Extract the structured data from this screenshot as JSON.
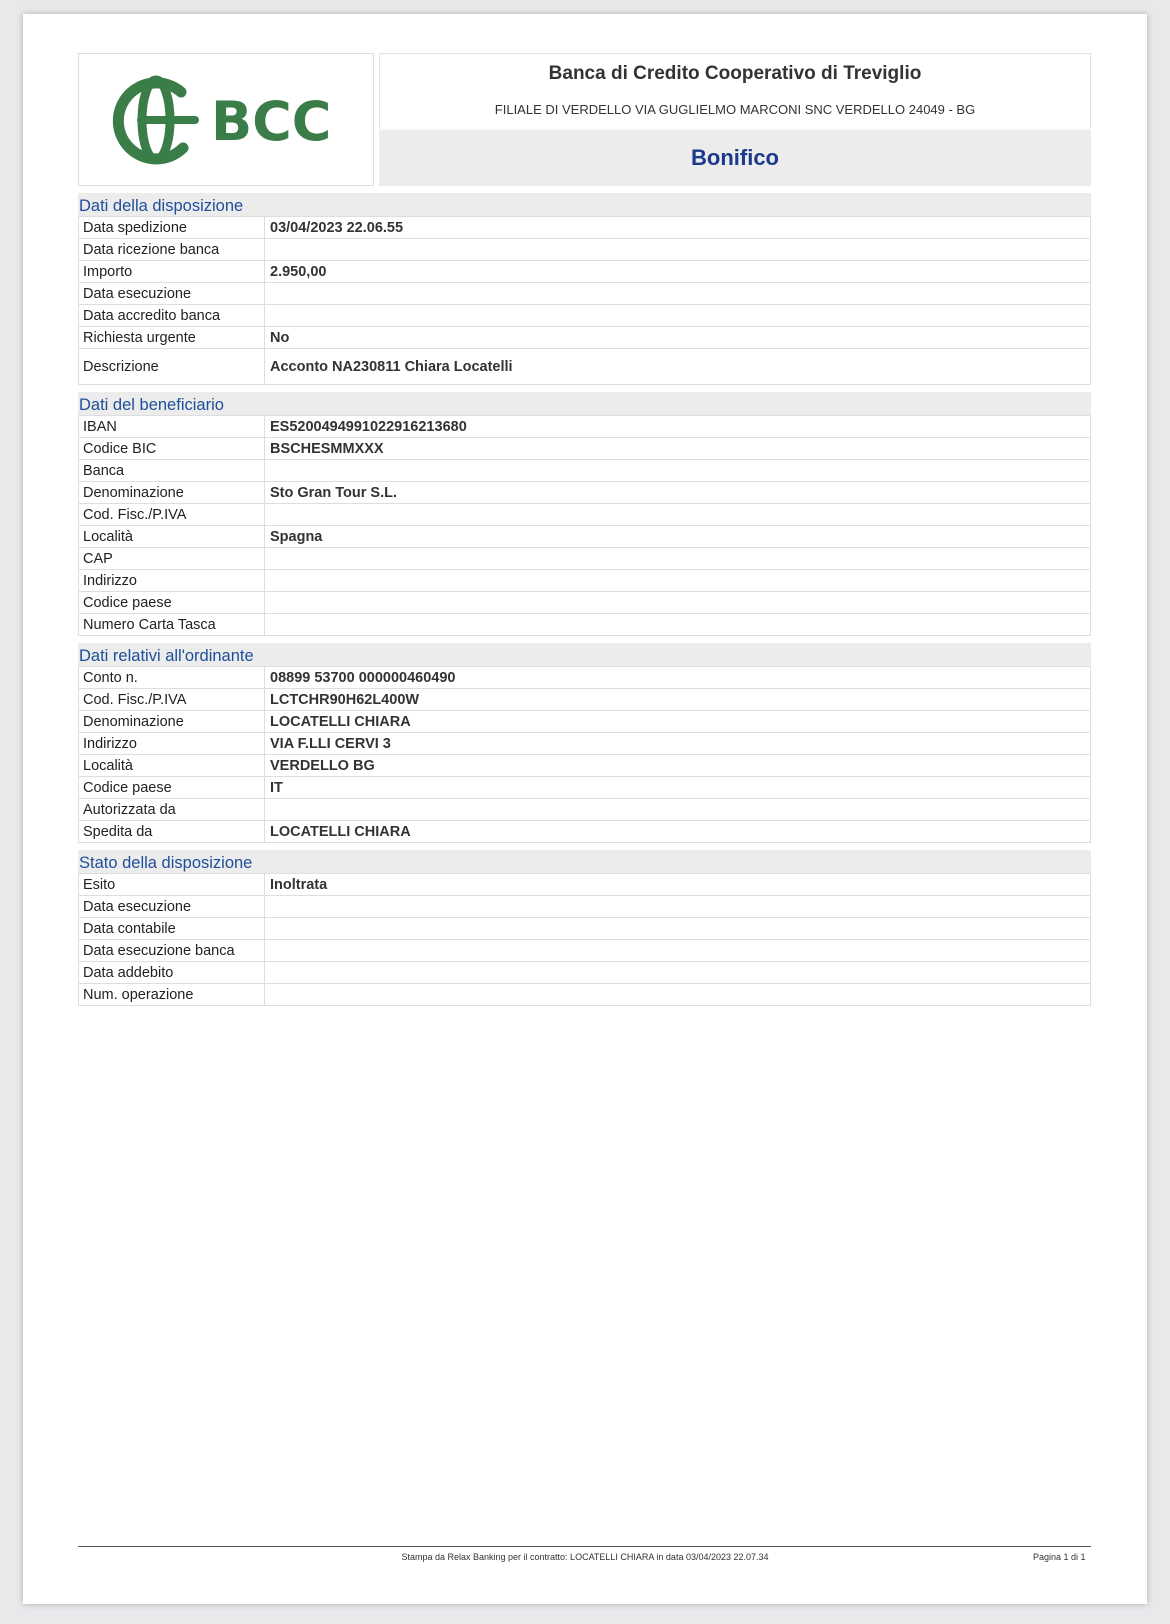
{
  "header": {
    "logo_text": "BCC",
    "bank_name": "Banca di Credito Cooperativo di Treviglio",
    "branch": "FILIALE DI VERDELLO VIA GUGLIELMO MARCONI SNC VERDELLO 24049 - BG",
    "document_title": "Bonifico"
  },
  "sections": [
    {
      "title": "Dati della disposizione",
      "rows": [
        {
          "label": "Data spedizione",
          "value": "03/04/2023 22.06.55"
        },
        {
          "label": "Data ricezione banca",
          "value": ""
        },
        {
          "label": "Importo",
          "value": "2.950,00"
        },
        {
          "label": "Data esecuzione",
          "value": ""
        },
        {
          "label": "Data accredito banca",
          "value": ""
        },
        {
          "label": "Richiesta urgente",
          "value": "No"
        },
        {
          "label": "Descrizione",
          "value": "Acconto  NA230811 Chiara Locatelli"
        }
      ]
    },
    {
      "title": "Dati del beneficiario",
      "rows": [
        {
          "label": "IBAN",
          "value": "ES5200494991022916213680"
        },
        {
          "label": "Codice BIC",
          "value": "BSCHESMMXXX"
        },
        {
          "label": "Banca",
          "value": ""
        },
        {
          "label": "Denominazione",
          "value": "Sto Gran Tour S.L."
        },
        {
          "label": "Cod. Fisc./P.IVA",
          "value": ""
        },
        {
          "label": "Località",
          "value": "Spagna"
        },
        {
          "label": "CAP",
          "value": ""
        },
        {
          "label": "Indirizzo",
          "value": ""
        },
        {
          "label": "Codice paese",
          "value": ""
        },
        {
          "label": "Numero Carta Tasca",
          "value": ""
        }
      ]
    },
    {
      "title": "Dati relativi all'ordinante",
      "rows": [
        {
          "label": "Conto n.",
          "value": "08899 53700 000000460490"
        },
        {
          "label": "Cod. Fisc./P.IVA",
          "value": "LCTCHR90H62L400W"
        },
        {
          "label": "Denominazione",
          "value": "LOCATELLI CHIARA"
        },
        {
          "label": "Indirizzo",
          "value": "VIA F.LLI CERVI 3"
        },
        {
          "label": "Località",
          "value": "VERDELLO BG"
        },
        {
          "label": "Codice paese",
          "value": "IT"
        },
        {
          "label": "Autorizzata da",
          "value": ""
        },
        {
          "label": "Spedita da",
          "value": "LOCATELLI CHIARA"
        }
      ]
    },
    {
      "title": "Stato della disposizione",
      "rows": [
        {
          "label": "Esito",
          "value": "Inoltrata"
        },
        {
          "label": "Data esecuzione",
          "value": ""
        },
        {
          "label": "Data contabile",
          "value": ""
        },
        {
          "label": "Data esecuzione banca",
          "value": ""
        },
        {
          "label": "Data addebito",
          "value": ""
        },
        {
          "label": "Num. operazione",
          "value": ""
        }
      ]
    }
  ],
  "footer": {
    "print_info": "Stampa da Relax Banking per il contratto: LOCATELLI CHIARA in data 03/04/2023 22.07.34",
    "page_label": "Pagina 1 di   1"
  },
  "colors": {
    "logo_green": "#3b7d48",
    "title_blue": "#1b3a8c",
    "section_blue": "#1f4e9a"
  }
}
